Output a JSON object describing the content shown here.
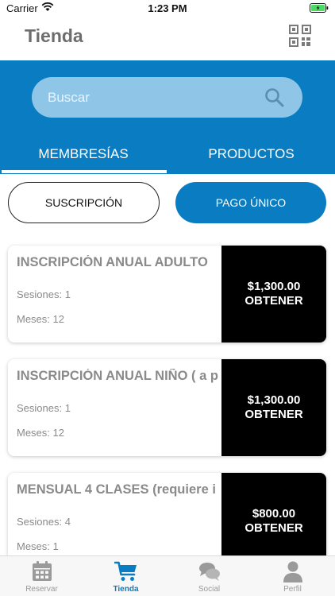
{
  "status_bar": {
    "carrier": "Carrier",
    "time": "1:23 PM"
  },
  "header": {
    "title": "Tienda",
    "qr_icon": "qr-code-icon"
  },
  "search": {
    "placeholder": "Buscar",
    "icon": "search-icon"
  },
  "tabs": [
    {
      "label": "MEMBRESÍAS",
      "active": true
    },
    {
      "label": "PRODUCTOS",
      "active": false
    }
  ],
  "segments": [
    {
      "label": "SUSCRIPCIÓN",
      "selected": false
    },
    {
      "label": "PAGO ÚNICO",
      "selected": true
    }
  ],
  "cards": [
    {
      "title": "INSCRIPCIÓN ANUAL ADULTO",
      "sesiones_label": "Sesiones:",
      "sesiones": "1",
      "meses_label": "Meses:",
      "meses": "12",
      "price": "$1,300.00",
      "action": "OBTENER"
    },
    {
      "title": "INSCRIPCIÓN ANUAL NIÑO ( a p",
      "sesiones_label": "Sesiones:",
      "sesiones": "1",
      "meses_label": "Meses:",
      "meses": "12",
      "price": "$1,300.00",
      "action": "OBTENER"
    },
    {
      "title": "MENSUAL 4 CLASES (requiere i",
      "sesiones_label": "Sesiones:",
      "sesiones": "4",
      "meses_label": "Meses:",
      "meses": "1",
      "price": "$800.00",
      "action": "OBTENER"
    }
  ],
  "tab_bar": [
    {
      "label": "Reservar",
      "icon": "calendar-icon",
      "active": false
    },
    {
      "label": "Tienda",
      "icon": "cart-icon",
      "active": true
    },
    {
      "label": "Social",
      "icon": "chat-bubbles-icon",
      "active": false
    },
    {
      "label": "Perfil",
      "icon": "person-icon",
      "active": false
    }
  ],
  "colors": {
    "primary": "#0a7dc2",
    "search_bg": "#8fc6e8",
    "price_bg": "#000000",
    "battery": "#4cd964"
  }
}
